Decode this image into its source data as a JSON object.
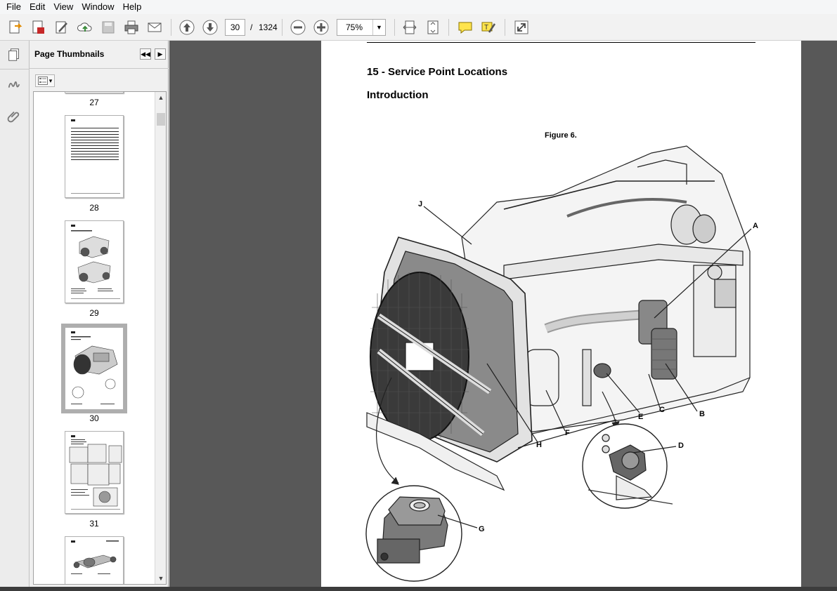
{
  "menu": {
    "items": [
      "File",
      "Edit",
      "View",
      "Window",
      "Help"
    ]
  },
  "toolbar": {
    "current_page": "30",
    "page_separator": "/",
    "total_pages": "1324",
    "zoom": "75%"
  },
  "panel": {
    "title": "Page Thumbnails"
  },
  "thumbnails": [
    {
      "label": "27"
    },
    {
      "label": "28"
    },
    {
      "label": "29"
    },
    {
      "label": "30",
      "selected": true
    },
    {
      "label": "31"
    }
  ],
  "document": {
    "section_title": "15 - Service Point Locations",
    "subtitle": "Introduction",
    "figure_caption": "Figure 6.",
    "callouts": [
      "J",
      "A",
      "B",
      "C",
      "E",
      "F",
      "H",
      "D",
      "G"
    ]
  },
  "colors": {
    "doc_bg": "#585858",
    "accent_green": "#3a8a3a",
    "toolbar_bg": "#f2f2f2"
  }
}
